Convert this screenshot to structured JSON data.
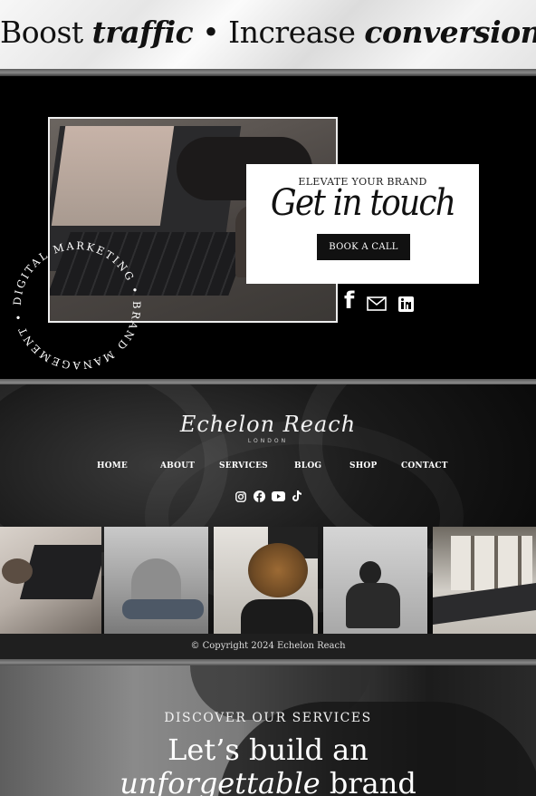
{
  "hero": {
    "part1": "Boost ",
    "em1": "traffic",
    "part2": " • Increase ",
    "em2": "conversions"
  },
  "contact": {
    "eyebrow": "ELEVATE YOUR BRAND",
    "script_title": "Get in touch",
    "button": "BOOK A CALL",
    "ring_text": "DIGITAL MARKETING • BRAND MANAGEMENT •",
    "social_icons": [
      "facebook-icon",
      "mail-icon",
      "linkedin-icon"
    ]
  },
  "footer": {
    "logo": "Echelon Reach",
    "logo_sub": "LONDON",
    "nav": [
      "HOME",
      "ABOUT",
      "SERVICES",
      "BLOG",
      "SHOP",
      "CONTACT"
    ],
    "social_icons": [
      "instagram-icon",
      "facebook-icon",
      "youtube-icon",
      "tiktok-icon"
    ],
    "copyright": "© Copyright 2024 Echelon Reach"
  },
  "services": {
    "eyebrow": "DISCOVER OUR SERVICES",
    "line1": "Let’s build an",
    "line2_em": "unforgettable",
    "line2_rest": " brand"
  }
}
